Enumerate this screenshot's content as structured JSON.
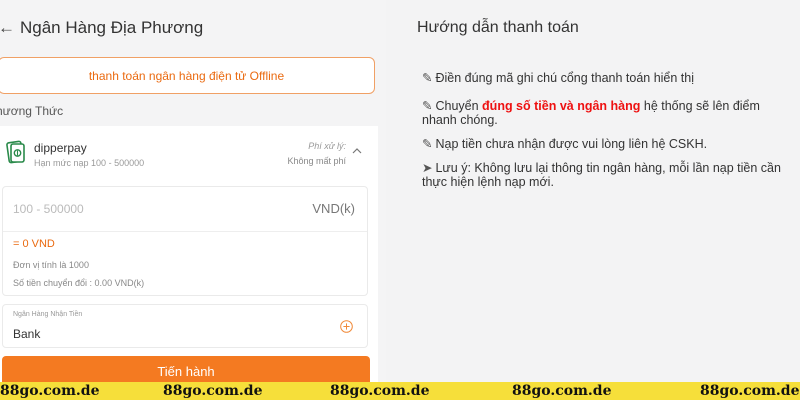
{
  "header": {
    "back_icon": "arrow-left-icon",
    "title": "Ngân Hàng Địa Phương"
  },
  "tab": {
    "label": "thanh toán ngân hàng điện tử Offline"
  },
  "method_section": {
    "label": "hương Thức"
  },
  "method": {
    "icon": "money-card-icon",
    "name": "dipperpay",
    "limit": "Hạn mức nạp 100 - 500000",
    "fee_label": "Phí xử lý:",
    "fee_value": "Không mất phí"
  },
  "amount": {
    "placeholder": "100 - 500000",
    "unit": "VND(k)",
    "equivalent": "= 0 VND",
    "unit_note": "Đơn vị tính là 1000",
    "conversion_note": "Số tiền chuyển đổi : 0.00 VND(k)"
  },
  "bank": {
    "label": "Ngân Hàng Nhận Tiền",
    "value": "Bank"
  },
  "submit_label": "Tiến hành",
  "guide": {
    "title": "Hướng dẫn thanh toán",
    "item1": "Điền đúng mã ghi chú cổng thanh toán hiển thị",
    "item2_pre": "Chuyển ",
    "item2_highlight": "đúng số tiền và ngân hàng",
    "item2_post": " hệ thống sẽ lên điểm nhanh chóng.",
    "item3": "Nạp tiền chưa nhận được vui lòng liên hệ CSKH.",
    "item4": "Lưu ý: Không lưu lại thông tin ngân hàng, mỗi lần nạp tiền cần thực hiện lệnh nạp mới.",
    "pencil": "✎",
    "arrow": "➤"
  },
  "watermark": {
    "text1": "88go.com.de",
    "text2": "88go.com.de",
    "text3": "88go.com.de",
    "text4": "88go.com.de",
    "text5": "88go.com.de"
  },
  "colors": {
    "accent": "#f47a21",
    "highlight": "#ee1111",
    "banner": "#f6df3a"
  }
}
